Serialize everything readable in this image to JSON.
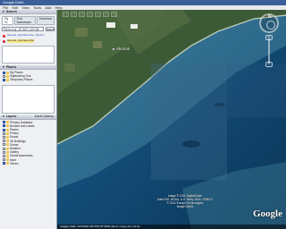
{
  "window": {
    "title": "Google Earth"
  },
  "menu": [
    "File",
    "Edit",
    "View",
    "Tools",
    "Add",
    "Help"
  ],
  "search": {
    "header": "Search",
    "tabs": [
      "Fly To",
      "Find Businesses",
      "Directions"
    ],
    "query": "Fly to e.g., 37 407, 122.08",
    "button": "Search"
  },
  "results": [
    {
      "title": "Akumal, Quintana Roo, Mexico"
    },
    {
      "title": "Akumal, Quintana Roo",
      "highlight": true
    }
  ],
  "places": {
    "header": "Places",
    "items": [
      {
        "label": "My Places",
        "checked": true
      },
      {
        "label": "Sightseeing Tour",
        "checked": false
      },
      {
        "label": "Temporary Places",
        "checked": true
      }
    ]
  },
  "layers": {
    "header": "Layers",
    "tab_gallery": "Earth Gallery",
    "items": [
      {
        "label": "Primary Database",
        "checked": true
      },
      {
        "label": "Borders and Labels",
        "checked": true
      },
      {
        "label": "Places",
        "checked": true
      },
      {
        "label": "Photos",
        "checked": false
      },
      {
        "label": "Roads",
        "checked": false
      },
      {
        "label": "3D Buildings",
        "checked": false
      },
      {
        "label": "Ocean",
        "checked": false
      },
      {
        "label": "Weather",
        "checked": false
      },
      {
        "label": "Gallery",
        "checked": false
      },
      {
        "label": "Global Awareness",
        "checked": false
      },
      {
        "label": "More",
        "checked": false
      },
      {
        "label": "Terrain",
        "checked": true
      }
    ]
  },
  "map": {
    "place_label": "Akumal",
    "credits": [
      "Image © 2011 DigitalGlobe",
      "Data SIO, NOAA, U.S. Navy, NGA, GEBCO",
      "© 2011 Europa Technologies",
      "Image NASA"
    ],
    "logo": "Google",
    "status": "Imagery Date: 2/27/2011   20°24'N  87°18'W   elev 0 m      Eye alt 1.41 km"
  }
}
